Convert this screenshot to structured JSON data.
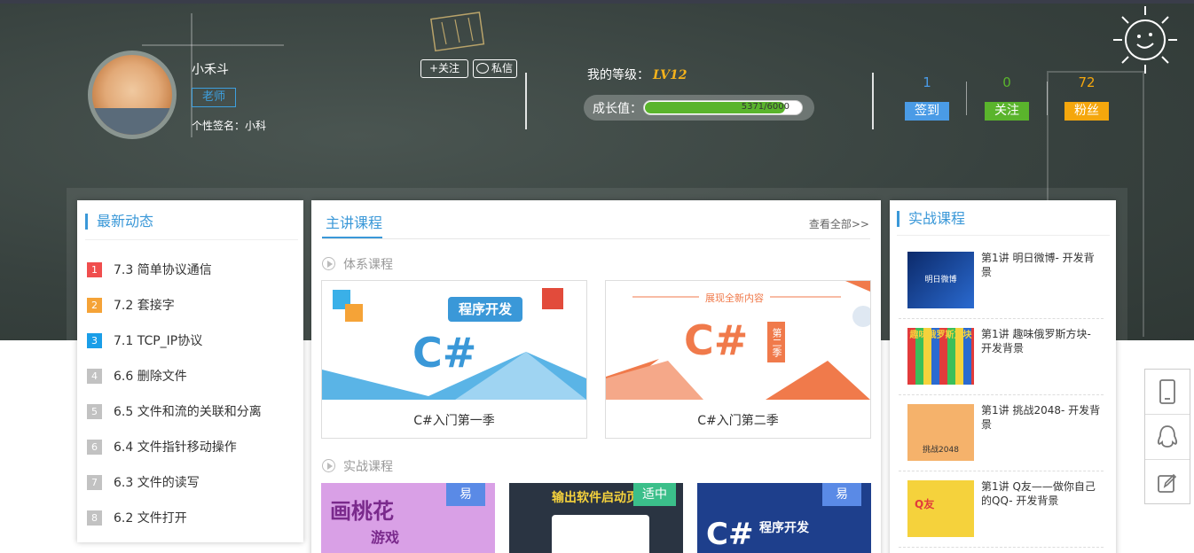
{
  "profile": {
    "name": "小禾斗",
    "role": "老师",
    "signature": "个性签名：小科",
    "follow_label": "+关注",
    "message_label": "私信"
  },
  "level": {
    "label": "我的等级：",
    "value": "LV12",
    "growth_label": "成长值：",
    "growth_text": "5371/6000",
    "growth_fraction": 0.895
  },
  "stats": [
    {
      "count": "1",
      "label": "签到",
      "color": "#4a9be6"
    },
    {
      "count": "0",
      "label": "关注",
      "color": "#5ab42c"
    },
    {
      "count": "72",
      "label": "粉丝",
      "color": "#f5a70d"
    }
  ],
  "news": {
    "title": "最新动态",
    "items": [
      {
        "num": "1",
        "text": "7.3 简单协议通信",
        "color": "#f04e4e"
      },
      {
        "num": "2",
        "text": "7.2 套接字",
        "color": "#f5a337"
      },
      {
        "num": "3",
        "text": "7.1 TCP_IP协议",
        "color": "#1a9ee8"
      },
      {
        "num": "4",
        "text": "6.6 删除文件",
        "color": "#c2c2c2"
      },
      {
        "num": "5",
        "text": "6.5 文件和流的关联和分离",
        "color": "#c2c2c2"
      },
      {
        "num": "6",
        "text": "6.4 文件指针移动操作",
        "color": "#c2c2c2"
      },
      {
        "num": "7",
        "text": "6.3 文件的读写",
        "color": "#c2c2c2"
      },
      {
        "num": "8",
        "text": "6.2 文件打开",
        "color": "#c2c2c2"
      }
    ]
  },
  "main": {
    "tab": "主讲课程",
    "view_all": "查看全部>>",
    "system_section": "体系课程",
    "practice_section": "实战课程",
    "system_courses": [
      {
        "name": "C#入门第一季",
        "banner": "程序开发",
        "big": "C#"
      },
      {
        "name": "C#入门第二季",
        "banner": "展现全新内容",
        "big": "C#",
        "side": "第二季"
      }
    ],
    "practice_courses": [
      {
        "badge": "易",
        "cover": "画桃花",
        "sub": "游戏"
      },
      {
        "badge": "适中",
        "cover": "输出软件启动页"
      },
      {
        "badge": "易",
        "cover": "程序开发",
        "big": "C#"
      }
    ]
  },
  "practice": {
    "title": "实战课程",
    "items": [
      {
        "text": "第1讲 明日微博- 开发背景",
        "cover": "明日微博"
      },
      {
        "text": "第1讲 趣味俄罗斯方块- 开发背景",
        "cover": "趣味俄罗斯方块"
      },
      {
        "text": "第1讲 挑战2048- 开发背景",
        "cover": "挑战2048"
      },
      {
        "text": "第1讲 Q友——做你自己的QQ- 开发背景",
        "cover": "Q友"
      }
    ]
  }
}
